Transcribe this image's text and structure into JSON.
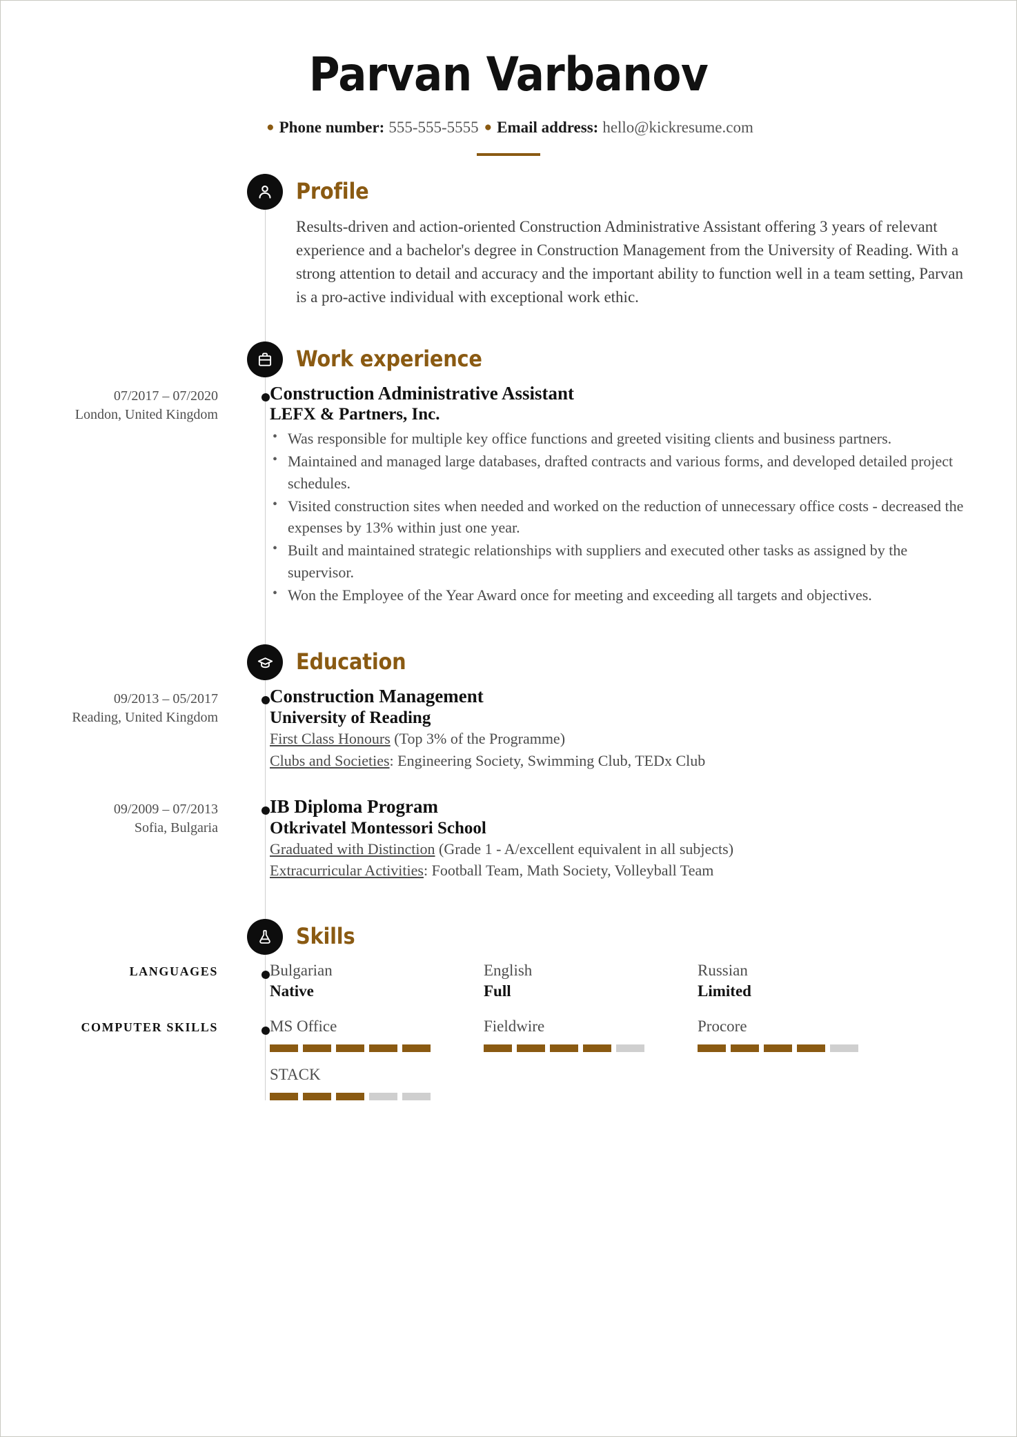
{
  "theme": {
    "accent": "#8a5a12",
    "badge_bg": "#0d0d0d",
    "bar_empty": "#cfcfcf",
    "text": "#3a3a3a",
    "timeline": "#cfcfcf"
  },
  "header": {
    "name": "Parvan Varbanov",
    "contact": {
      "phone_label": "Phone number:",
      "phone_value": "555-555-5555",
      "email_label": "Email address:",
      "email_value": "hello@kickresume.com",
      "bullet_glyph": "●"
    }
  },
  "sections": {
    "profile": {
      "title": "Profile",
      "icon": "person-icon",
      "text": "Results-driven and action-oriented Construction Administrative Assistant offering 3 years of relevant experience and a bachelor's degree in Construction Management from the University of Reading. With a strong attention to detail and accuracy and the important ability to function well in a team setting, Parvan is a pro-active individual with exceptional work ethic."
    },
    "work": {
      "title": "Work experience",
      "icon": "briefcase-icon",
      "entries": [
        {
          "dates": "07/2017 – 07/2020",
          "location": "London, United Kingdom",
          "title": "Construction Administrative Assistant",
          "company": "LEFX & Partners, Inc.",
          "bullets": [
            "Was responsible for multiple key office functions and greeted visiting clients and business partners.",
            "Maintained and managed large databases, drafted contracts and various forms, and developed detailed project schedules.",
            "Visited construction sites when needed and worked on the reduction of unnecessary office costs - decreased the expenses by 13% within just one year.",
            "Built and maintained strategic relationships with suppliers and executed other tasks as assigned by the supervisor.",
            "Won the Employee of the Year Award once for meeting and exceeding all targets and objectives."
          ]
        }
      ]
    },
    "education": {
      "title": "Education",
      "icon": "graduation-cap-icon",
      "entries": [
        {
          "dates": "09/2013 – 05/2017",
          "location": "Reading, United Kingdom",
          "title": "Construction Management",
          "school": "University of Reading",
          "notes": [
            {
              "underlined": "First Class Honours",
              "rest": " (Top 3% of the Programme)"
            },
            {
              "underlined": "Clubs and Societies",
              "rest": ": Engineering Society, Swimming Club, TEDx Club"
            }
          ]
        },
        {
          "dates": "09/2009 – 07/2013",
          "location": "Sofia, Bulgaria",
          "title": "IB Diploma Program",
          "school": "Otkrivatel Montessori School",
          "notes": [
            {
              "underlined": "Graduated with Distinction",
              "rest": " (Grade 1 - A/excellent equivalent in all subjects)"
            },
            {
              "underlined": "Extracurricular Activities",
              "rest": ": Football Team, Math Society, Volleyball Team"
            }
          ]
        }
      ]
    },
    "skills": {
      "title": "Skills",
      "icon": "flask-icon",
      "languages": {
        "label": "LANGUAGES",
        "items": [
          {
            "name": "Bulgarian",
            "level": "Native"
          },
          {
            "name": "English",
            "level": "Full"
          },
          {
            "name": "Russian",
            "level": "Limited"
          }
        ]
      },
      "computer": {
        "label": "COMPUTER SKILLS",
        "total_bars": 5,
        "items": [
          {
            "name": "MS Office",
            "filled": 5
          },
          {
            "name": "Fieldwire",
            "filled": 4
          },
          {
            "name": "Procore",
            "filled": 4
          },
          {
            "name": "STACK",
            "filled": 3
          }
        ]
      }
    }
  }
}
